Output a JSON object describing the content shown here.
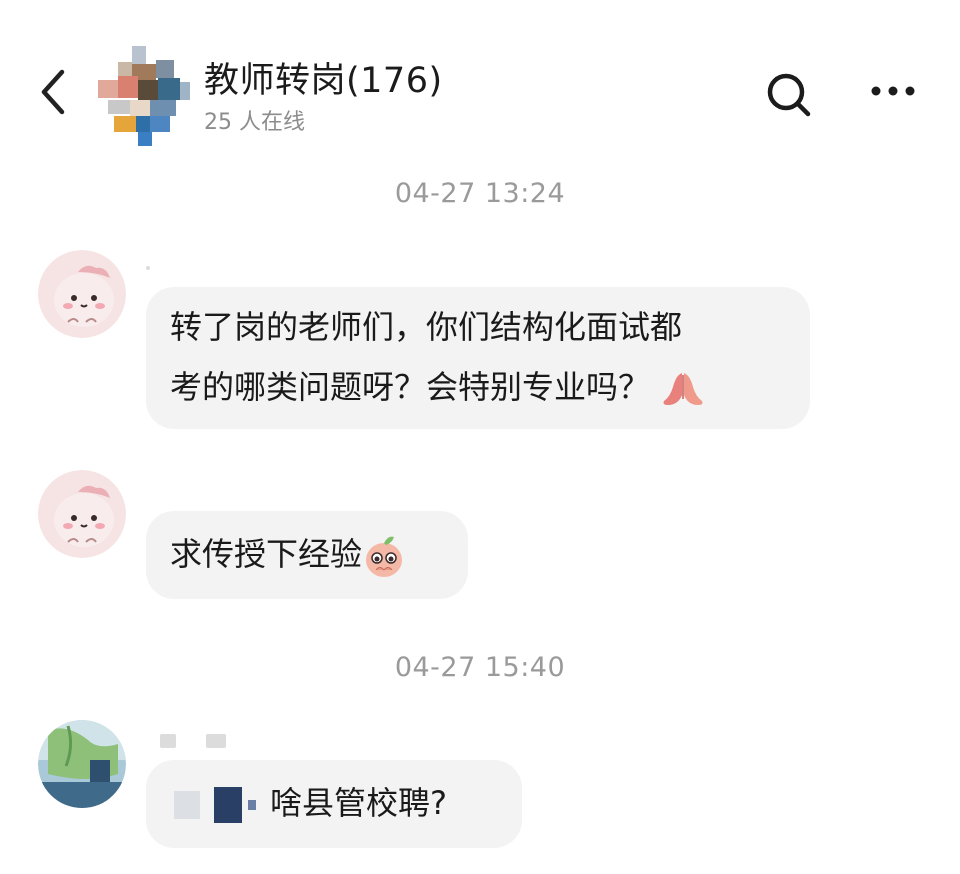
{
  "header": {
    "title": "教师转岗(176)",
    "online": "25 人在线",
    "back_icon": "chevron-left-icon",
    "search_icon": "search-icon",
    "more_icon": "more-horizontal-icon"
  },
  "messages": [
    {
      "timestamp": "04-27 13:24",
      "lines": [
        "转了岗的老师们，你们结构化面试都",
        "考的哪类问题呀？会特别专业吗？"
      ],
      "emoji": "praying-hands-icon"
    },
    {
      "text": "求传授下经验",
      "emoji": "pleading-face-sticker-icon"
    },
    {
      "timestamp": "04-27 15:40",
      "text": "啥县管校聘?"
    }
  ],
  "colors": {
    "bubble_bg": "#f3f3f3",
    "timestamp": "#9a9a9a",
    "subtitle": "#8c8c8c",
    "avatar_pink": "#f6d9dc"
  }
}
